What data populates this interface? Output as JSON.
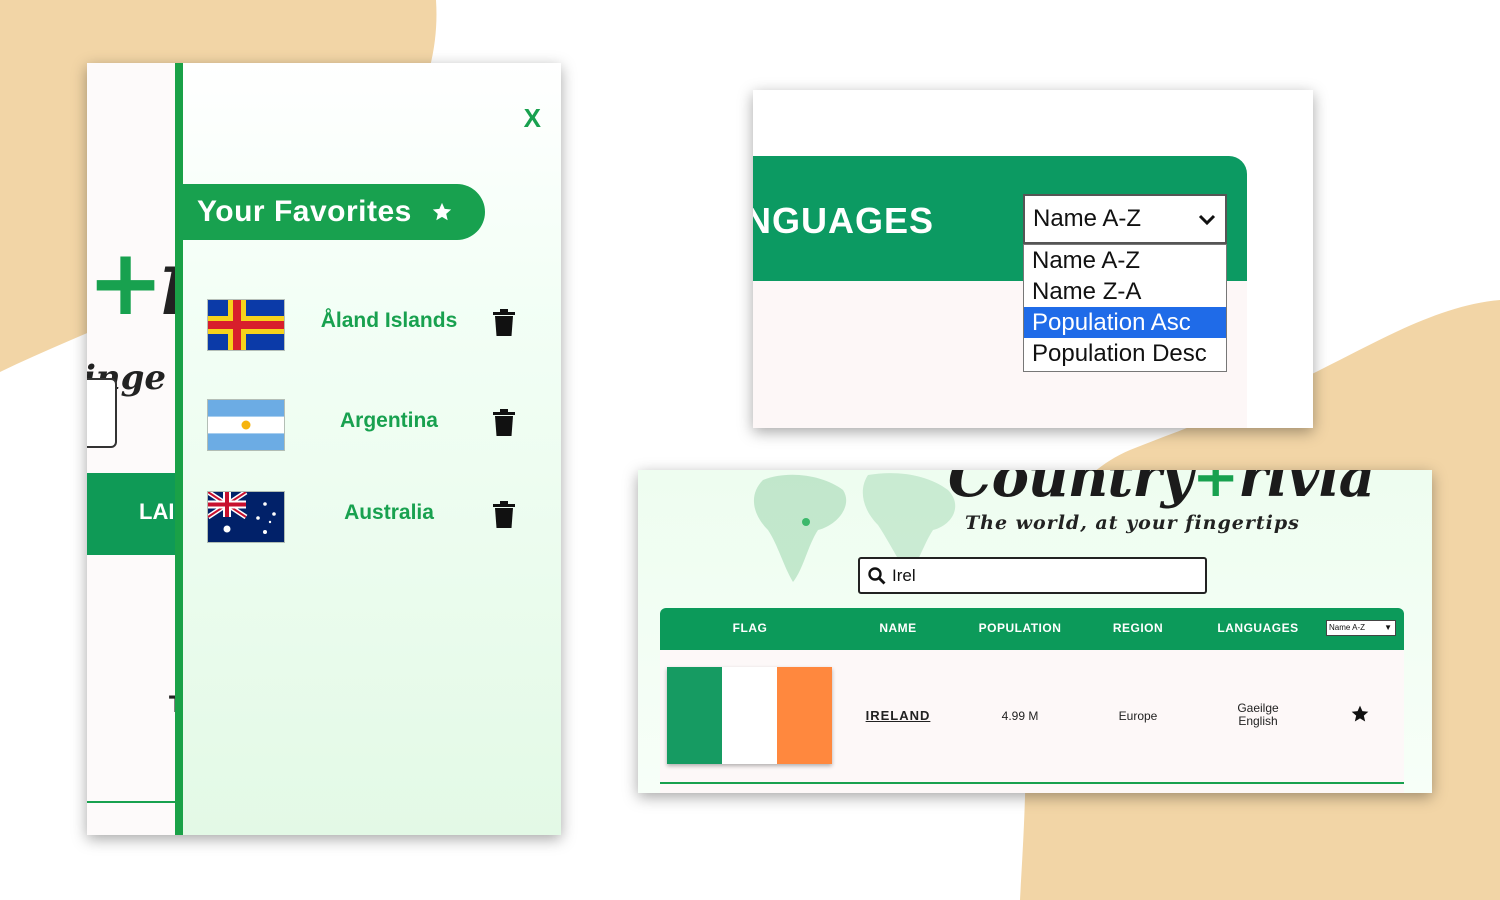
{
  "colors": {
    "brand_green": "#18a14f",
    "header_green": "#0c9a5a",
    "blob_tan": "#f2d5a6",
    "highlight_blue": "#1f6be8"
  },
  "favorites_panel": {
    "background_title_fragment": "ri",
    "background_subtitle_fragment": "inge",
    "background_header_fragment": "LAI",
    "background_cell_fragment": "T",
    "close_label": "X",
    "heading": "Your Favorites",
    "heading_icon": "star-icon",
    "items": [
      {
        "name": "Åland Islands",
        "flag": "aland-flag",
        "remove_icon": "trash-icon"
      },
      {
        "name": "Argentina",
        "flag": "argentina-flag",
        "remove_icon": "trash-icon"
      },
      {
        "name": "Australia",
        "flag": "australia-flag",
        "remove_icon": "trash-icon"
      }
    ]
  },
  "sort_panel": {
    "column_fragment": "NGUAGES",
    "selected": "Name A-Z",
    "options": [
      "Name A-Z",
      "Name Z-A",
      "Population Asc",
      "Population Desc"
    ],
    "highlighted_option": "Population Asc"
  },
  "result_panel": {
    "title_left": "Country",
    "title_right": "rivia",
    "subtitle": "The world, at your fingertips",
    "search_value": "Irel",
    "search_icon": "search-icon",
    "columns": [
      "FLAG",
      "NAME",
      "POPULATION",
      "REGION",
      "LANGUAGES"
    ],
    "sort_value": "Name A-Z",
    "rows": [
      {
        "name": "IRELAND",
        "population": "4.99 M",
        "region": "Europe",
        "languages": [
          "Gaeilge",
          "English"
        ],
        "flag": "ireland-flag",
        "favorite_icon": "star-icon"
      }
    ]
  }
}
